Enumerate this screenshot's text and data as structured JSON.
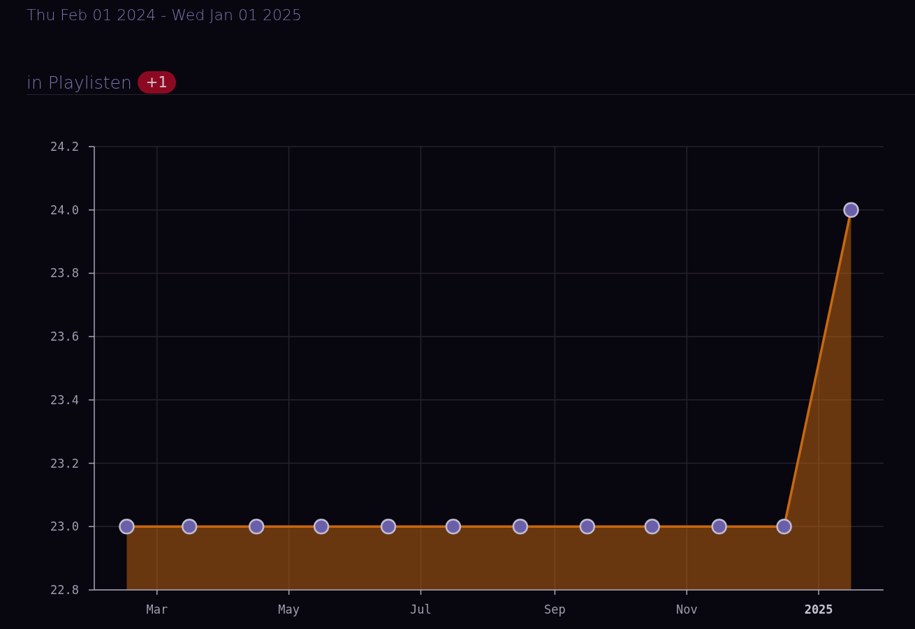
{
  "date_range": "Thu Feb 01 2024 - Wed Jan 01 2025",
  "section": {
    "badge": "+1"
  },
  "chart_data": {
    "type": "area",
    "title": "in Playlisten",
    "grid": true,
    "x": [
      "2024-02-16",
      "2024-03-16",
      "2024-04-16",
      "2024-05-16",
      "2024-06-16",
      "2024-07-16",
      "2024-08-16",
      "2024-09-16",
      "2024-10-16",
      "2024-11-16",
      "2024-12-16",
      "2025-01-16"
    ],
    "series": [
      {
        "color": "#c7680f",
        "values": [
          23,
          23,
          23,
          23,
          23,
          23,
          23,
          23,
          23,
          23,
          23,
          24
        ]
      }
    ],
    "xlim": [
      "2024-02-01",
      "2025-01-31"
    ],
    "ylim": [
      22.8,
      24.2
    ],
    "xticks": [
      {
        "value": "2024-03-01",
        "label": "Mar"
      },
      {
        "value": "2024-05-01",
        "label": "May"
      },
      {
        "value": "2024-07-01",
        "label": "Jul"
      },
      {
        "value": "2024-09-01",
        "label": "Sep"
      },
      {
        "value": "2024-11-01",
        "label": "Nov"
      },
      {
        "value": "2025-01-01",
        "label": "2025"
      }
    ],
    "yticks": [
      {
        "value": 22.8,
        "label": "22.8"
      },
      {
        "value": 23.0,
        "label": "23.0"
      },
      {
        "value": 23.2,
        "label": "23.2"
      },
      {
        "value": 23.4,
        "label": "23.4"
      },
      {
        "value": 23.6,
        "label": "23.6"
      },
      {
        "value": 23.8,
        "label": "23.8"
      },
      {
        "value": 24.0,
        "label": "24.0"
      },
      {
        "value": 24.2,
        "label": "24.2"
      }
    ]
  }
}
